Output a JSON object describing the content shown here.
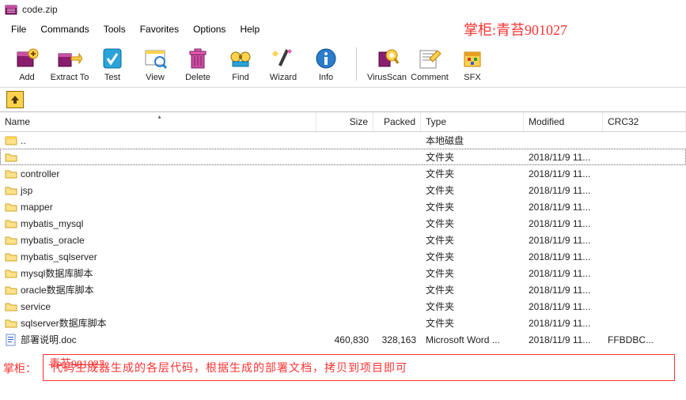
{
  "window": {
    "title": "code.zip"
  },
  "watermark": {
    "top": "掌柜:青苔901027",
    "bottom_left_label": "掌柜：",
    "overlay": "青苔901027"
  },
  "menu": {
    "file": "File",
    "commands": "Commands",
    "tools": "Tools",
    "favorites": "Favorites",
    "options": "Options",
    "help": "Help"
  },
  "toolbar": {
    "add": "Add",
    "extract": "Extract To",
    "test": "Test",
    "view": "View",
    "delete": "Delete",
    "find": "Find",
    "wizard": "Wizard",
    "info": "Info",
    "virusscan": "VirusScan",
    "comment": "Comment",
    "sfx": "SFX"
  },
  "columns": {
    "name": "Name",
    "size": "Size",
    "packed": "Packed",
    "type": "Type",
    "modified": "Modified",
    "crc": "CRC32"
  },
  "rows": [
    {
      "icon": "disk",
      "name": "..",
      "size": "",
      "packed": "",
      "type": "本地磁盘",
      "modified": "",
      "crc": ""
    },
    {
      "icon": "folder",
      "name": "",
      "size": "",
      "packed": "",
      "type": "文件夹",
      "modified": "2018/11/9 11...",
      "crc": "",
      "selected": true
    },
    {
      "icon": "folder",
      "name": "controller",
      "size": "",
      "packed": "",
      "type": "文件夹",
      "modified": "2018/11/9 11...",
      "crc": ""
    },
    {
      "icon": "folder",
      "name": "jsp",
      "size": "",
      "packed": "",
      "type": "文件夹",
      "modified": "2018/11/9 11...",
      "crc": ""
    },
    {
      "icon": "folder",
      "name": "mapper",
      "size": "",
      "packed": "",
      "type": "文件夹",
      "modified": "2018/11/9 11...",
      "crc": ""
    },
    {
      "icon": "folder",
      "name": "mybatis_mysql",
      "size": "",
      "packed": "",
      "type": "文件夹",
      "modified": "2018/11/9 11...",
      "crc": ""
    },
    {
      "icon": "folder",
      "name": "mybatis_oracle",
      "size": "",
      "packed": "",
      "type": "文件夹",
      "modified": "2018/11/9 11...",
      "crc": ""
    },
    {
      "icon": "folder",
      "name": "mybatis_sqlserver",
      "size": "",
      "packed": "",
      "type": "文件夹",
      "modified": "2018/11/9 11...",
      "crc": ""
    },
    {
      "icon": "folder",
      "name": "mysql数据库脚本",
      "size": "",
      "packed": "",
      "type": "文件夹",
      "modified": "2018/11/9 11...",
      "crc": ""
    },
    {
      "icon": "folder",
      "name": "oracle数据库脚本",
      "size": "",
      "packed": "",
      "type": "文件夹",
      "modified": "2018/11/9 11...",
      "crc": ""
    },
    {
      "icon": "folder",
      "name": "service",
      "size": "",
      "packed": "",
      "type": "文件夹",
      "modified": "2018/11/9 11...",
      "crc": ""
    },
    {
      "icon": "folder",
      "name": "sqlserver数据库脚本",
      "size": "",
      "packed": "",
      "type": "文件夹",
      "modified": "2018/11/9 11...",
      "crc": ""
    },
    {
      "icon": "doc",
      "name": "部署说明.doc",
      "size": "460,830",
      "packed": "328,163",
      "type": "Microsoft Word ...",
      "modified": "2018/11/9 11...",
      "crc": "FFBDBC..."
    }
  ],
  "description": "代码生成器生成的各层代码，根据生成的部署文档，拷贝到项目即可"
}
